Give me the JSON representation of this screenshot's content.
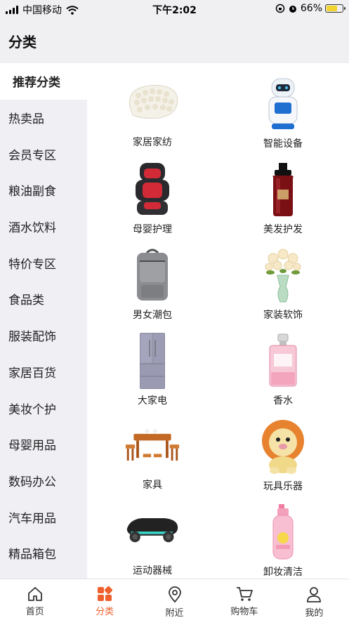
{
  "status_bar": {
    "carrier": "中国移动",
    "time": "下午2:02",
    "battery": "66%",
    "battery_level": 0.66
  },
  "header": {
    "title": "分类"
  },
  "sidebar": {
    "items": [
      {
        "label": "推荐分类"
      },
      {
        "label": "热卖品"
      },
      {
        "label": "会员专区"
      },
      {
        "label": "粮油副食"
      },
      {
        "label": "酒水饮料"
      },
      {
        "label": "特价专区"
      },
      {
        "label": "食品类"
      },
      {
        "label": "服装配饰"
      },
      {
        "label": "家居百货"
      },
      {
        "label": "美妆个护"
      },
      {
        "label": "母婴用品"
      },
      {
        "label": "数码办公"
      },
      {
        "label": "汽车用品"
      },
      {
        "label": "精品箱包"
      }
    ]
  },
  "categories": [
    {
      "label": "家居家纺",
      "icon": "pillow-icon"
    },
    {
      "label": "智能设备",
      "icon": "robot-icon"
    },
    {
      "label": "母婴护理",
      "icon": "car-seat-icon"
    },
    {
      "label": "美发护发",
      "icon": "shampoo-bottle-icon"
    },
    {
      "label": "男女潮包",
      "icon": "backpack-icon"
    },
    {
      "label": "家装软饰",
      "icon": "flower-vase-icon"
    },
    {
      "label": "大家电",
      "icon": "refrigerator-icon"
    },
    {
      "label": "香水",
      "icon": "perfume-icon"
    },
    {
      "label": "家具",
      "icon": "furniture-icon"
    },
    {
      "label": "玩具乐器",
      "icon": "lion-toy-icon"
    },
    {
      "label": "运动器械",
      "icon": "skate-board-icon"
    },
    {
      "label": "卸妆清洁",
      "icon": "cleanser-bottle-icon"
    }
  ],
  "tabbar": {
    "items": [
      {
        "label": "首页",
        "icon": "home-icon"
      },
      {
        "label": "分类",
        "icon": "category-icon"
      },
      {
        "label": "附近",
        "icon": "location-icon"
      },
      {
        "label": "购物车",
        "icon": "cart-icon"
      },
      {
        "label": "我的",
        "icon": "user-icon"
      }
    ]
  },
  "colors": {
    "accent": "#f0602d",
    "sidebar_bg": "#efeff4"
  }
}
